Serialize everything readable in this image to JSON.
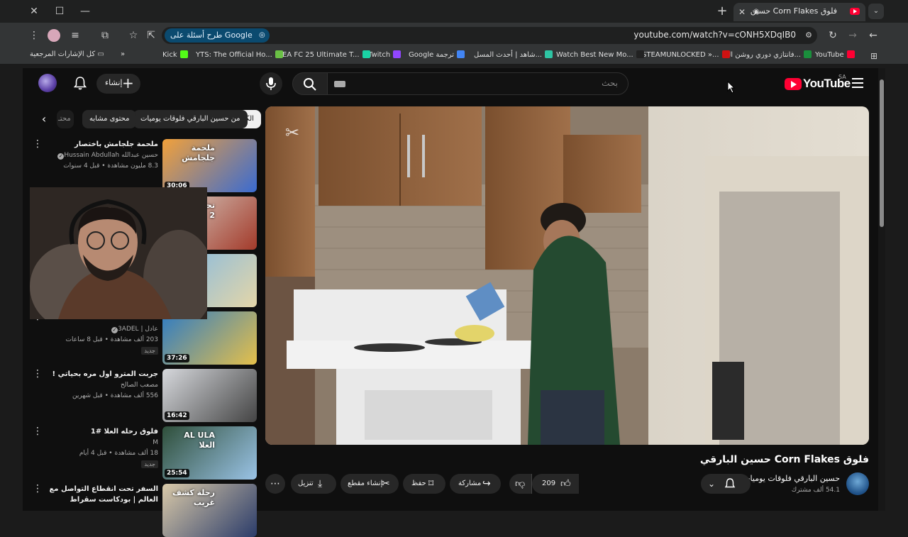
{
  "browser": {
    "tab_title": "فلوق  Corn Flakes حسين",
    "url": "youtube.com/watch?v=cONH5XDqIB0",
    "google_pill": "طرح أسئلة على Google",
    "bookmarks_all": "كل الإشارات المرجعية",
    "bookmarks": [
      {
        "label": "YouTube",
        "color": "#ff0033"
      },
      {
        "label": "فانتازي دوري روشن ال...",
        "color": "#1a8f3c"
      },
      {
        "label": "STEAMUNLOCKED »...",
        "color": "#d01212"
      },
      {
        "label": "Watch Best New Mo...",
        "color": "#222222"
      },
      {
        "label": "شاهد | أحدث المسل...",
        "color": "#2ec4a3"
      },
      {
        "label": "Google ترجمة",
        "color": "#4285f4"
      },
      {
        "label": "Twitch",
        "color": "#9146ff"
      },
      {
        "label": "EA FC 25 Ultimate T...",
        "color": "#1ad3a4"
      },
      {
        "label": "YTS: The Official Ho...",
        "color": "#6ac045"
      },
      {
        "label": "Kick",
        "color": "#53fc18"
      }
    ]
  },
  "header": {
    "logo_text": "YouTube",
    "country": "SA",
    "search_placeholder": "بحث",
    "create_label": "إنشاء"
  },
  "chips": [
    "الكل",
    "من حسين البارقي فلوقات يوميات",
    "محتوى مشابه",
    "محتـ"
  ],
  "video": {
    "title": "فلوق  Corn Flakes حسين البارقي",
    "channel": "حسين البارقي فلوقات يوميات",
    "subscribers": "54.1 ألف مشترك",
    "likes": "209",
    "share_label": "مشاركة",
    "save_label": "حفظ",
    "clip_label": "إنشاء مقطع",
    "download_label": "تنزيل"
  },
  "recommendations": [
    {
      "title": "ملحمة جلجامش باختصار",
      "channel": "حسين عبدالله Hussain Abdullah",
      "meta": "8.3 مليون مشاهدة • قبل 4 سنوات",
      "duration": "30:06",
      "is_new": false,
      "thumb_text": "ملحمة جلجامش"
    },
    {
      "title": "",
      "channel": "",
      "meta": "",
      "duration": "",
      "is_new": false,
      "thumb_text": "تحديات حمد 2"
    },
    {
      "title": "",
      "channel": "",
      "meta": "",
      "duration": "",
      "is_new": false,
      "thumb_text": ""
    },
    {
      "title": "",
      "channel": "عادل | 3ADEL",
      "meta": "203 ألف مشاهدة • قبل 8 ساعات",
      "duration": "37:26",
      "is_new": true,
      "new_label": "جديد",
      "thumb_text": ""
    },
    {
      "title": "جربت المترو اول مره بحياتي !",
      "channel": "مصعب الصالح",
      "meta": "556 ألف مشاهدة • قبل شهرين",
      "duration": "16:42",
      "is_new": false,
      "thumb_text": ""
    },
    {
      "title": "فلوق رحله العلا #1",
      "channel": "M",
      "meta": "18 ألف مشاهدة • قبل 4 أيام",
      "duration": "25:54",
      "is_new": true,
      "new_label": "جديد",
      "thumb_text": "AL ULA العلا"
    },
    {
      "title": "السفر تحت انقطاع التواصل مع العالم | بودكاست سقراط",
      "channel": "",
      "meta": "",
      "duration": "",
      "is_new": false,
      "thumb_text": "رحلة كشف غريب"
    }
  ]
}
